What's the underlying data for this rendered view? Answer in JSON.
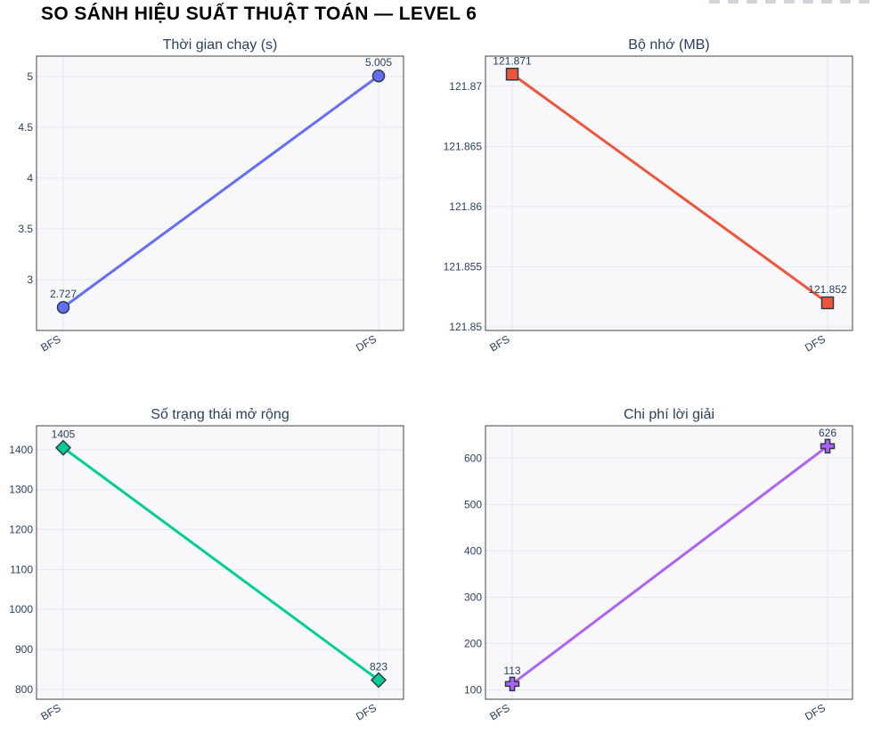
{
  "title": "SO SÁNH HIỆU SUẤT THUẬT TOÁN — LEVEL 6",
  "modebar_icons": [
    "camera-icon",
    "zoom-icon",
    "pan-icon",
    "box-select-icon",
    "lasso-icon",
    "zoom-in-icon",
    "zoom-out-icon",
    "autoscale-icon",
    "reset-axes-icon"
  ],
  "chart_data": [
    {
      "type": "line",
      "title": "Thời gian chạy (s)",
      "categories": [
        "BFS",
        "DFS"
      ],
      "values": [
        2.727,
        5.005
      ],
      "data_labels": [
        "2.727",
        "5.005"
      ],
      "yticks": [
        3,
        3.5,
        4,
        4.5,
        5
      ],
      "ytick_labels": [
        "3",
        "3.5",
        "4",
        "4.5",
        "5"
      ],
      "ylim": [
        2.5,
        5.2
      ],
      "color": "#636efa",
      "marker": "circle",
      "grid": true
    },
    {
      "type": "line",
      "title": "Bộ nhớ (MB)",
      "categories": [
        "BFS",
        "DFS"
      ],
      "values": [
        121.871,
        121.852
      ],
      "data_labels": [
        "121.871",
        "121.852"
      ],
      "yticks": [
        121.85,
        121.855,
        121.86,
        121.865,
        121.87
      ],
      "ytick_labels": [
        "121.85",
        "121.855",
        "121.86",
        "121.865",
        "121.87"
      ],
      "ylim": [
        121.8497,
        121.8725
      ],
      "color": "#ef553b",
      "marker": "square",
      "grid": true
    },
    {
      "type": "line",
      "title": "Số trạng thái mở rộng",
      "categories": [
        "BFS",
        "DFS"
      ],
      "values": [
        1405,
        823
      ],
      "data_labels": [
        "1405",
        "823"
      ],
      "yticks": [
        800,
        900,
        1000,
        1100,
        1200,
        1300,
        1400
      ],
      "ytick_labels": [
        "800",
        "900",
        "1000",
        "1100",
        "1200",
        "1300",
        "1400"
      ],
      "ylim": [
        775,
        1460
      ],
      "color": "#00cc96",
      "marker": "diamond",
      "grid": true
    },
    {
      "type": "line",
      "title": "Chi phí lời giải",
      "categories": [
        "BFS",
        "DFS"
      ],
      "values": [
        113,
        626
      ],
      "data_labels": [
        "113",
        "626"
      ],
      "yticks": [
        100,
        200,
        300,
        400,
        500,
        600
      ],
      "ytick_labels": [
        "100",
        "200",
        "300",
        "400",
        "500",
        "600"
      ],
      "ylim": [
        80,
        670
      ],
      "color": "#ab63fa",
      "marker": "cross",
      "grid": true
    }
  ]
}
